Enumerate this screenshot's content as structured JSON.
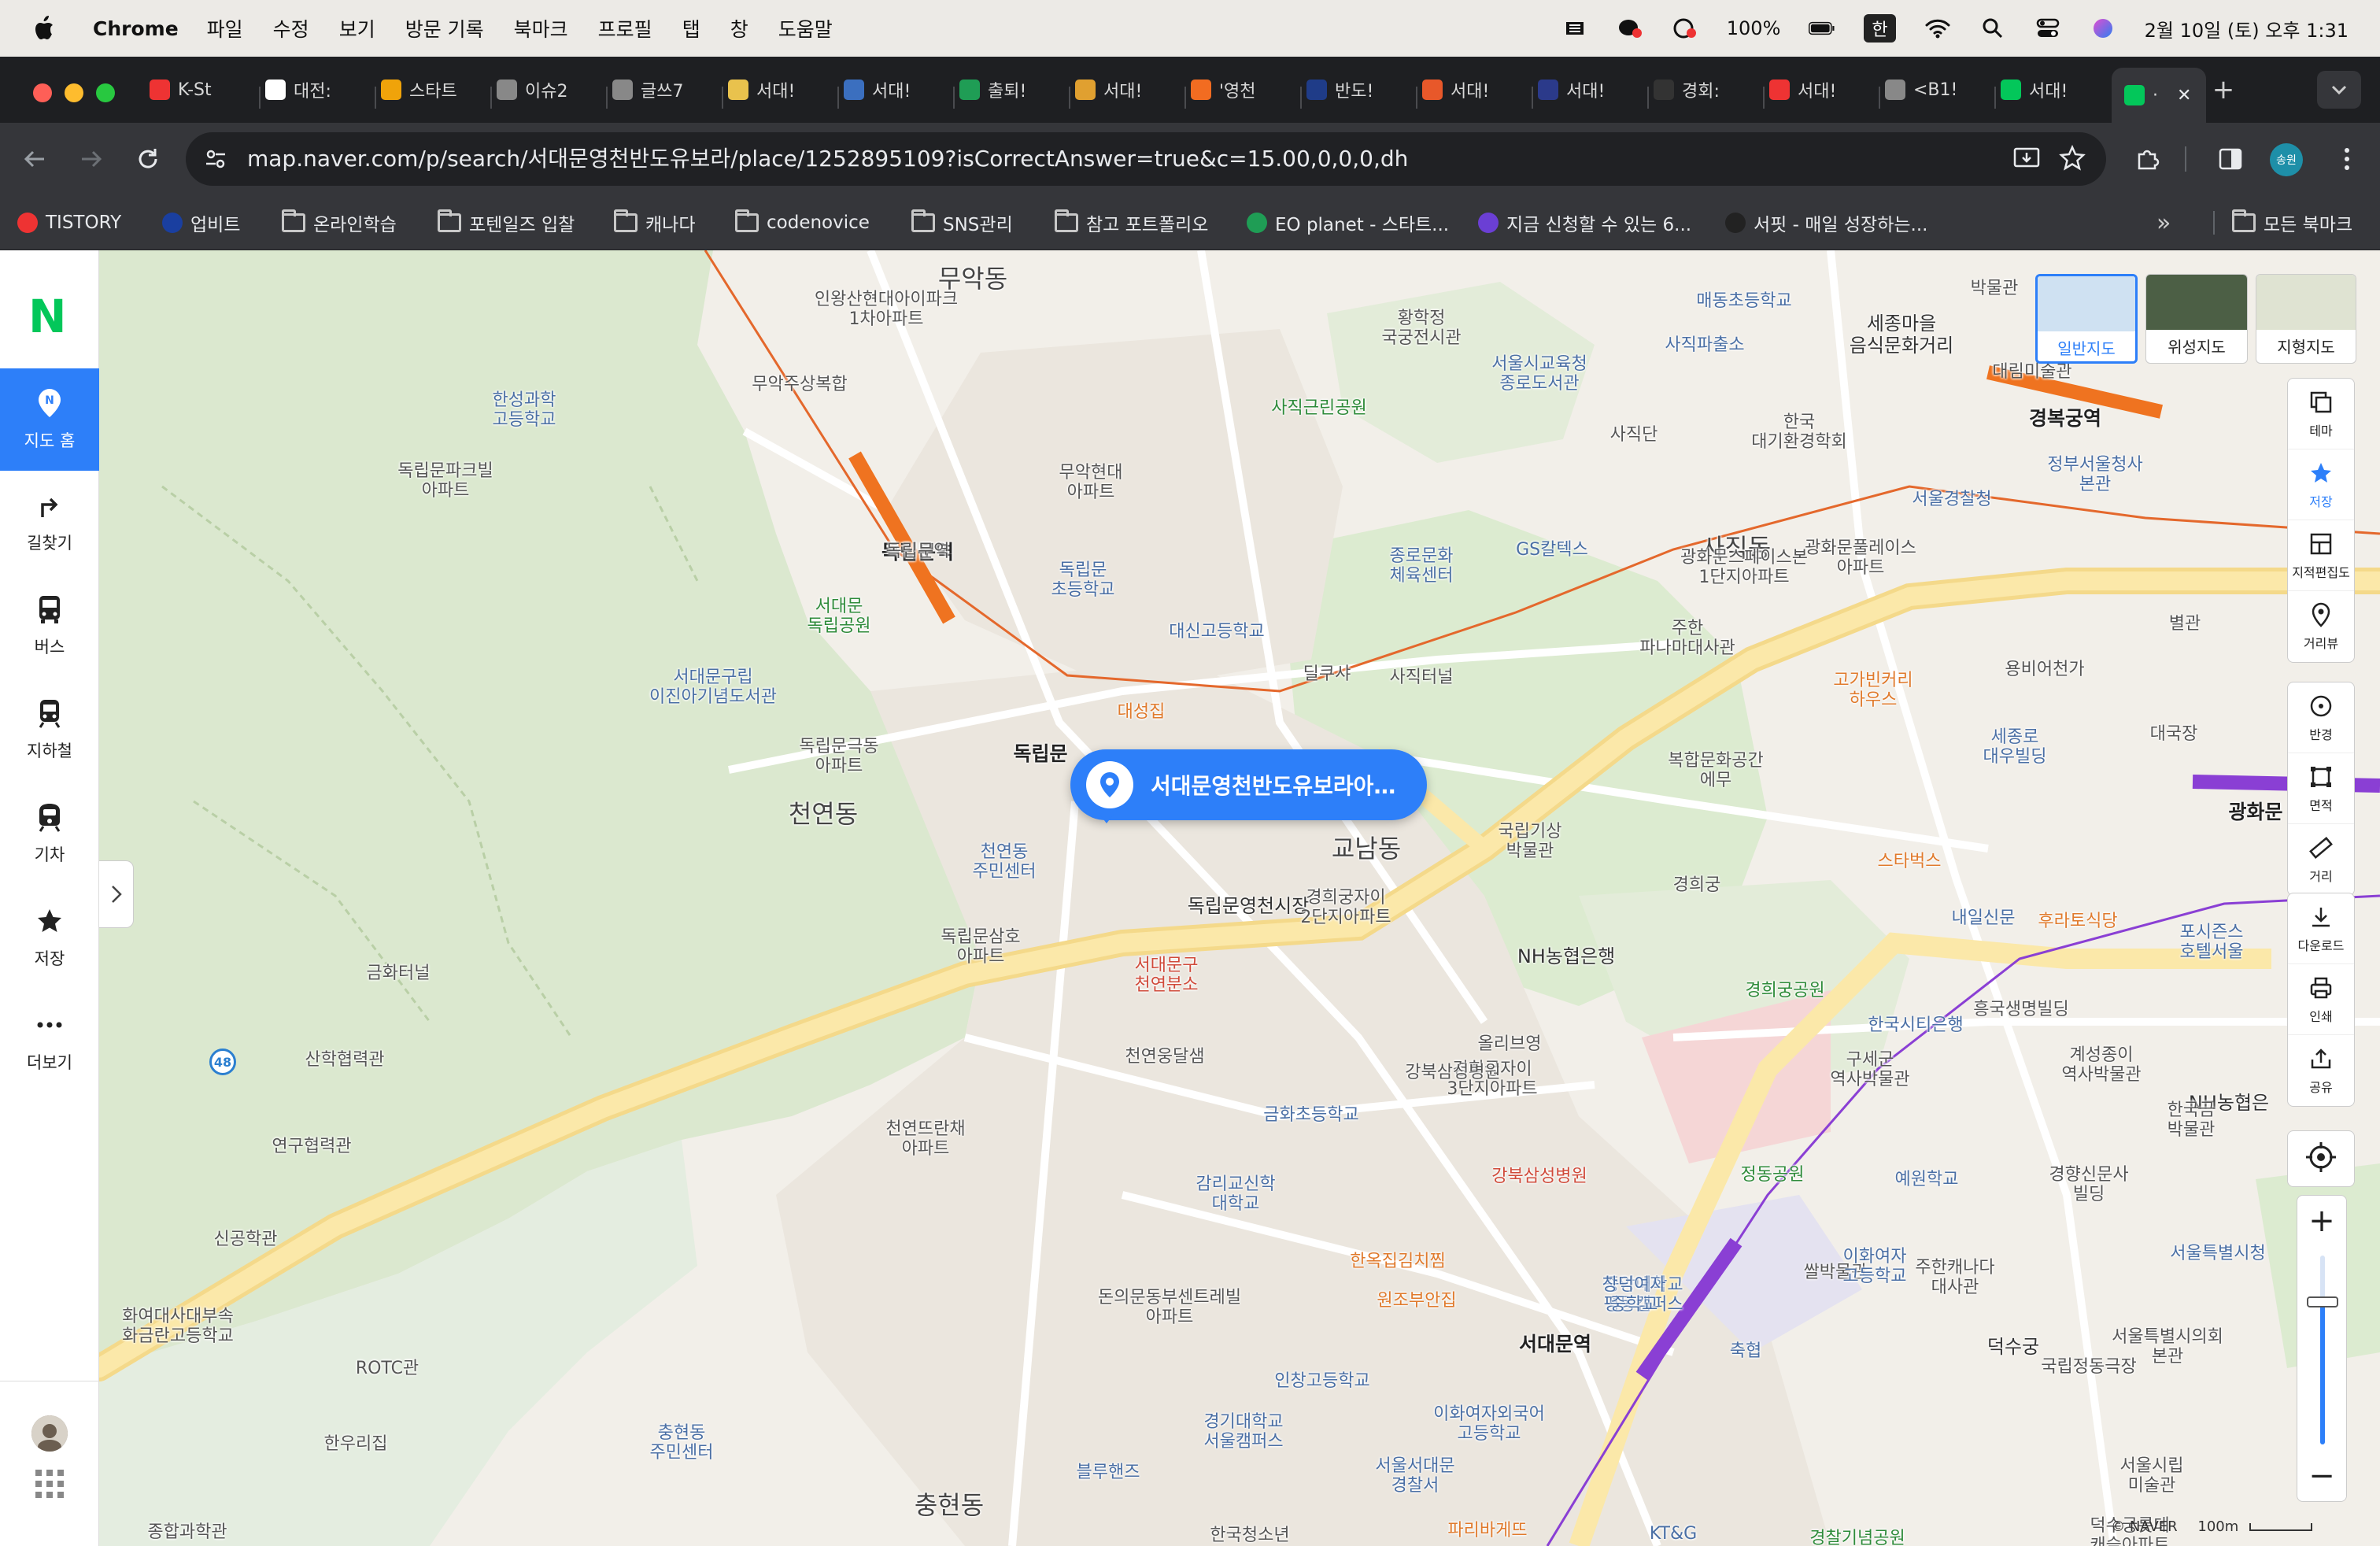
{
  "menubar": {
    "app": "Chrome",
    "items": [
      "파일",
      "수정",
      "보기",
      "방문 기록",
      "북마크",
      "프로필",
      "탭",
      "창",
      "도움말"
    ],
    "battery": "100%",
    "input_method": "한",
    "datetime": "2월 10일 (토) 오후 1:31"
  },
  "tabs": [
    {
      "label": "K-St",
      "color": "#e33"
    },
    {
      "label": "대전:",
      "color": "#fff"
    },
    {
      "label": "스타트",
      "color": "#f0a30a"
    },
    {
      "label": "이슈2",
      "color": "#888"
    },
    {
      "label": "글쓰7",
      "color": "#888"
    },
    {
      "label": "서대!",
      "color": "#e9c24d"
    },
    {
      "label": "서대!",
      "color": "#3b6fbf"
    },
    {
      "label": "출퇴!",
      "color": "#1f9d55"
    },
    {
      "label": "서대!",
      "color": "#e0a030"
    },
    {
      "label": "'영천",
      "color": "#f26c21"
    },
    {
      "label": "반도!",
      "color": "#1f3c88"
    },
    {
      "label": "서대!",
      "color": "#e8582a"
    },
    {
      "label": "서대!",
      "color": "#2b3a8a"
    },
    {
      "label": "경회:",
      "color": "#333"
    },
    {
      "label": "서대!",
      "color": "#e33"
    },
    {
      "label": "<B1!",
      "color": "#888"
    },
    {
      "label": "서대!",
      "color": "#03c75a"
    },
    {
      "label": "·",
      "color": "#03c75a"
    }
  ],
  "url": "map.naver.com/p/search/서대문영천반도유보라/place/1252895109?isCorrectAnswer=true&c=15.00,0,0,0,dh",
  "profile_label": "송원",
  "bookmarks": [
    {
      "label": "TISTORY",
      "type": "site"
    },
    {
      "label": "업비트",
      "type": "site"
    },
    {
      "label": "온라인학습",
      "type": "folder"
    },
    {
      "label": "포텐일즈 입찰",
      "type": "folder"
    },
    {
      "label": "캐나다",
      "type": "folder"
    },
    {
      "label": "codenovice",
      "type": "folder"
    },
    {
      "label": "SNS관리",
      "type": "folder"
    },
    {
      "label": "참고 포트폴리오",
      "type": "folder"
    },
    {
      "label": "EO planet - 스타트...",
      "type": "site"
    },
    {
      "label": "지금 신청할 수 있는 6...",
      "type": "site"
    },
    {
      "label": "서핏 - 매일 성장하는...",
      "type": "site"
    }
  ],
  "all_bookmarks": "모든 북마크",
  "sidebar": {
    "logo": "N",
    "items": [
      {
        "label": "지도 홈",
        "icon": "map-pin-icon"
      },
      {
        "label": "길찾기",
        "icon": "directions-icon"
      },
      {
        "label": "버스",
        "icon": "bus-icon"
      },
      {
        "label": "지하철",
        "icon": "subway-icon"
      },
      {
        "label": "기차",
        "icon": "train-icon"
      },
      {
        "label": "저장",
        "icon": "star-icon"
      },
      {
        "label": "더보기",
        "icon": "more-icon"
      }
    ]
  },
  "map": {
    "pin_label": "서대문영천반도유보라아…",
    "map_types": [
      "일반지도",
      "위성지도",
      "지형지도"
    ],
    "tools": [
      "테마",
      "저장",
      "지적편집도",
      "거리뷰",
      "반경",
      "면적",
      "거리",
      "다운로드",
      "인쇄",
      "공유"
    ],
    "copyright": "© NAVER",
    "scale": "100m",
    "labels": [
      {
        "t": "무악동",
        "c": "big"
      },
      {
        "t": "천연동",
        "c": "big"
      },
      {
        "t": "충현동",
        "c": "big"
      },
      {
        "t": "사직동",
        "c": "big"
      },
      {
        "t": "교남동",
        "c": "big"
      },
      {
        "t": "독립문역",
        "c": "station"
      },
      {
        "t": "경복궁역",
        "c": "station"
      },
      {
        "t": "서대문역",
        "c": "station"
      },
      {
        "t": "광화문",
        "c": "station"
      },
      {
        "t": "독립문",
        "c": "station"
      },
      {
        "t": "독립문영천시장",
        "c": "dark"
      },
      {
        "t": "세종마을\n음식문화거리",
        "c": "dark"
      },
      {
        "t": "인왕산현대아이파크\n1차아파트",
        "c": ""
      },
      {
        "t": "무악주상복합",
        "c": ""
      },
      {
        "t": "한성과학\n고등학교",
        "c": "blue"
      },
      {
        "t": "독립문파크빌\n아파트",
        "c": ""
      },
      {
        "t": "무악현대\n아파트",
        "c": ""
      },
      {
        "t": "독립문\n초등학교",
        "c": "blue"
      },
      {
        "t": "대신고등학교",
        "c": "blue"
      },
      {
        "t": "서대문\n독립공원",
        "c": "green"
      },
      {
        "t": "서대문구립\n이진아기념도서관",
        "c": "blue"
      },
      {
        "t": "독립문극동\n아파트",
        "c": ""
      },
      {
        "t": "천연동\n주민센터",
        "c": "blue"
      },
      {
        "t": "독립문삼호\n아파트",
        "c": ""
      },
      {
        "t": "서대문구\n천연분소",
        "c": "red"
      },
      {
        "t": "천연웅달샘",
        "c": ""
      },
      {
        "t": "천연뜨란채\n아파트",
        "c": ""
      },
      {
        "t": "금화초등학교",
        "c": "blue"
      },
      {
        "t": "감리교신학\n대학교",
        "c": "blue"
      },
      {
        "t": "한옥집김치찜",
        "c": "orange"
      },
      {
        "t": "돈의문동부센트레빌\n아파트",
        "c": ""
      },
      {
        "t": "원조부안집",
        "c": "orange"
      },
      {
        "t": "인창고등학교",
        "c": "blue"
      },
      {
        "t": "경기대학교\n서울캠퍼스",
        "c": "blue"
      },
      {
        "t": "블루핸즈",
        "c": "blue"
      },
      {
        "t": "한국청소년",
        "c": ""
      },
      {
        "t": "충현동\n주민센터",
        "c": "blue"
      },
      {
        "t": "한우리집",
        "c": ""
      },
      {
        "t": "ROTC관",
        "c": ""
      },
      {
        "t": "종합과학관",
        "c": ""
      },
      {
        "t": "신공학관",
        "c": ""
      },
      {
        "t": "연구협력관",
        "c": ""
      },
      {
        "t": "산학협력관",
        "c": ""
      },
      {
        "t": "화여대사대부속\n화금란고등학교",
        "c": ""
      },
      {
        "t": "금화터널",
        "c": ""
      },
      {
        "t": "사직터널",
        "c": ""
      },
      {
        "t": "대성집",
        "c": "orange"
      },
      {
        "t": "딜쿠샤",
        "c": ""
      },
      {
        "t": "황학정\n국궁전시관",
        "c": ""
      },
      {
        "t": "사직근린공원",
        "c": "green"
      },
      {
        "t": "서울시교육청\n종로도서관",
        "c": "blue"
      },
      {
        "t": "매동초등학교",
        "c": "blue"
      },
      {
        "t": "사직파출소",
        "c": "blue"
      },
      {
        "t": "사직단",
        "c": ""
      },
      {
        "t": "한국\n대기환경학회",
        "c": ""
      },
      {
        "t": "종로문화\n체육센터",
        "c": "blue"
      },
      {
        "t": "GS칼텍스",
        "c": "blue"
      },
      {
        "t": "광화문스페이스본\n1단지아파트",
        "c": ""
      },
      {
        "t": "광화문풀레이스\n아파트",
        "c": ""
      },
      {
        "t": "서울경찰청",
        "c": "blue"
      },
      {
        "t": "주한\n파나마대사관",
        "c": ""
      },
      {
        "t": "고가빈커리\n하우스",
        "c": "orange"
      },
      {
        "t": "복합문화공간\n에무",
        "c": ""
      },
      {
        "t": "국립기상\n박물관",
        "c": ""
      },
      {
        "t": "경희궁",
        "c": ""
      },
      {
        "t": "경희궁자이\n2단지아파트",
        "c": ""
      },
      {
        "t": "NH농협은행",
        "c": "dark"
      },
      {
        "t": "올리브영",
        "c": ""
      },
      {
        "t": "경희궁자이\n3단지아파트",
        "c": ""
      },
      {
        "t": "강북삼성병원",
        "c": "red"
      },
      {
        "t": "중앙대학교\n평동캠퍼스",
        "c": "blue"
      },
      {
        "t": "쌀박물관",
        "c": ""
      },
      {
        "t": "창덕여자\n중학교",
        "c": "blue"
      },
      {
        "t": "축협",
        "c": "blue"
      },
      {
        "t": "이화여자외국어\n고등학교",
        "c": "blue"
      },
      {
        "t": "서울서대문\n경찰서",
        "c": "blue"
      },
      {
        "t": "파리바게뜨",
        "c": "orange"
      },
      {
        "t": "KT&G",
        "c": "blue"
      },
      {
        "t": "경찰기념공원",
        "c": "green"
      },
      {
        "t": "덕수궁롯데\n캐슬아파트",
        "c": ""
      },
      {
        "t": "서울시립\n미술관",
        "c": ""
      },
      {
        "t": "서울특별시청",
        "c": "blue"
      },
      {
        "t": "서울특별시의회\n본관",
        "c": ""
      },
      {
        "t": "덕수궁",
        "c": "dark"
      },
      {
        "t": "국립정동극장",
        "c": ""
      },
      {
        "t": "이화여자\n고등학교",
        "c": "blue"
      },
      {
        "t": "주한캐나다\n대사관",
        "c": ""
      },
      {
        "t": "예원학교",
        "c": "blue"
      },
      {
        "t": "정동공원",
        "c": "green"
      },
      {
        "t": "경향신문사\n빌딩",
        "c": ""
      },
      {
        "t": "구세군\n역사박물관",
        "c": ""
      },
      {
        "t": "한국시티은행",
        "c": "blue"
      },
      {
        "t": "경희궁공원",
        "c": "green"
      },
      {
        "t": "흥국생명빌딩",
        "c": ""
      },
      {
        "t": "계성종이\n역사박물관",
        "c": ""
      },
      {
        "t": "내일신문",
        "c": "blue"
      },
      {
        "t": "포시즌스\n호텔서울",
        "c": "blue"
      },
      {
        "t": "NH농협은",
        "c": "dark"
      },
      {
        "t": "한국금\n박물관",
        "c": ""
      },
      {
        "t": "스타벅스",
        "c": "orange"
      },
      {
        "t": "후라토식당",
        "c": "orange"
      },
      {
        "t": "세종로\n대우빌딩",
        "c": "blue"
      },
      {
        "t": "대국장",
        "c": ""
      },
      {
        "t": "용비어천가",
        "c": ""
      },
      {
        "t": "별관",
        "c": ""
      },
      {
        "t": "정부서울청사\n본관",
        "c": "blue"
      },
      {
        "t": "박물관",
        "c": ""
      },
      {
        "t": "대림미술관",
        "c": ""
      },
      {
        "t": "강북삼성병원",
        "c": ""
      },
      {
        "t": "독립문역",
        "c": ""
      }
    ]
  }
}
